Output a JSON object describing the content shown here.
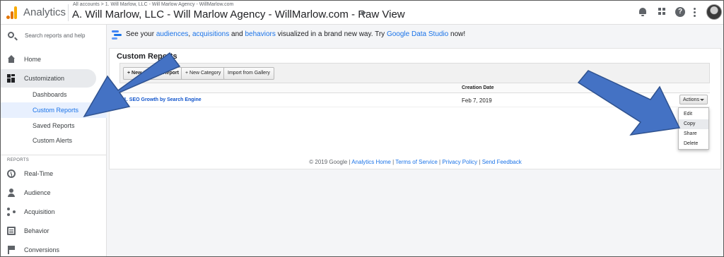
{
  "header": {
    "app_title": "Analytics",
    "breadcrumb": "All accounts > 1. Will Marlow, LLC - Will Marlow Agency - WillMarlow.com",
    "view_title": "A. Will Marlow, LLC - Will Marlow Agency - WillMarlow.com - Raw View",
    "help_glyph": "?"
  },
  "sidebar": {
    "search_placeholder": "Search reports and help",
    "home": "Home",
    "customization": "Customization",
    "sub_items": [
      "Dashboards",
      "Custom Reports",
      "Saved Reports",
      "Custom Alerts"
    ],
    "reports_caption": "REPORTS",
    "report_items": [
      "Real-Time",
      "Audience",
      "Acquisition",
      "Behavior",
      "Conversions"
    ]
  },
  "promo": {
    "prefix": "See your ",
    "link1": "audiences",
    "sep1": ", ",
    "link2": "acquisitions",
    "sep2": " and ",
    "link3": "behaviors",
    "mid": " visualized in a brand new way. Try ",
    "link4": "Google Data Studio",
    "suffix": " now!"
  },
  "custom_reports": {
    "title": "Custom Reports",
    "buttons": [
      "+ New Custom Report",
      "+ New Category",
      "Import from Gallery"
    ],
    "column_creation_date": "Creation Date",
    "rows": [
      {
        "name": "1. SEO Growth by Search Engine",
        "date": "Feb 7, 2019",
        "actions_label": "Actions"
      }
    ],
    "actions_menu": [
      "Edit",
      "Copy",
      "Share",
      "Delete"
    ]
  },
  "footer": {
    "copyright": "© 2019 Google | ",
    "links": [
      "Analytics Home",
      "Terms of Service",
      "Privacy Policy",
      "Send Feedback"
    ],
    "sep": " | "
  },
  "colors": {
    "accent": "#1a73e8",
    "arrow": "#4472c4"
  }
}
